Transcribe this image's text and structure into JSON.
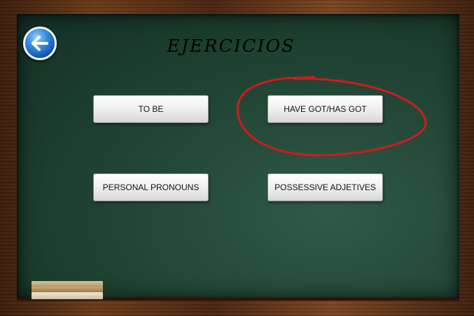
{
  "app": {
    "title": "EJERCICIOS"
  },
  "navigation": {
    "back_icon": "back-arrow-icon"
  },
  "menu": {
    "to_be": "TO BE",
    "have_got": "HAVE GOT/HAS GOT",
    "personal_pronouns": "PERSONAL PRONOUNS",
    "possessive_adjetives": "POSSESSIVE ADJETIVES"
  },
  "theme": {
    "board_color": "#234838",
    "frame_color": "#6b3a17",
    "annotation_color": "#d11a1a",
    "back_button_color": "#1559b8"
  }
}
